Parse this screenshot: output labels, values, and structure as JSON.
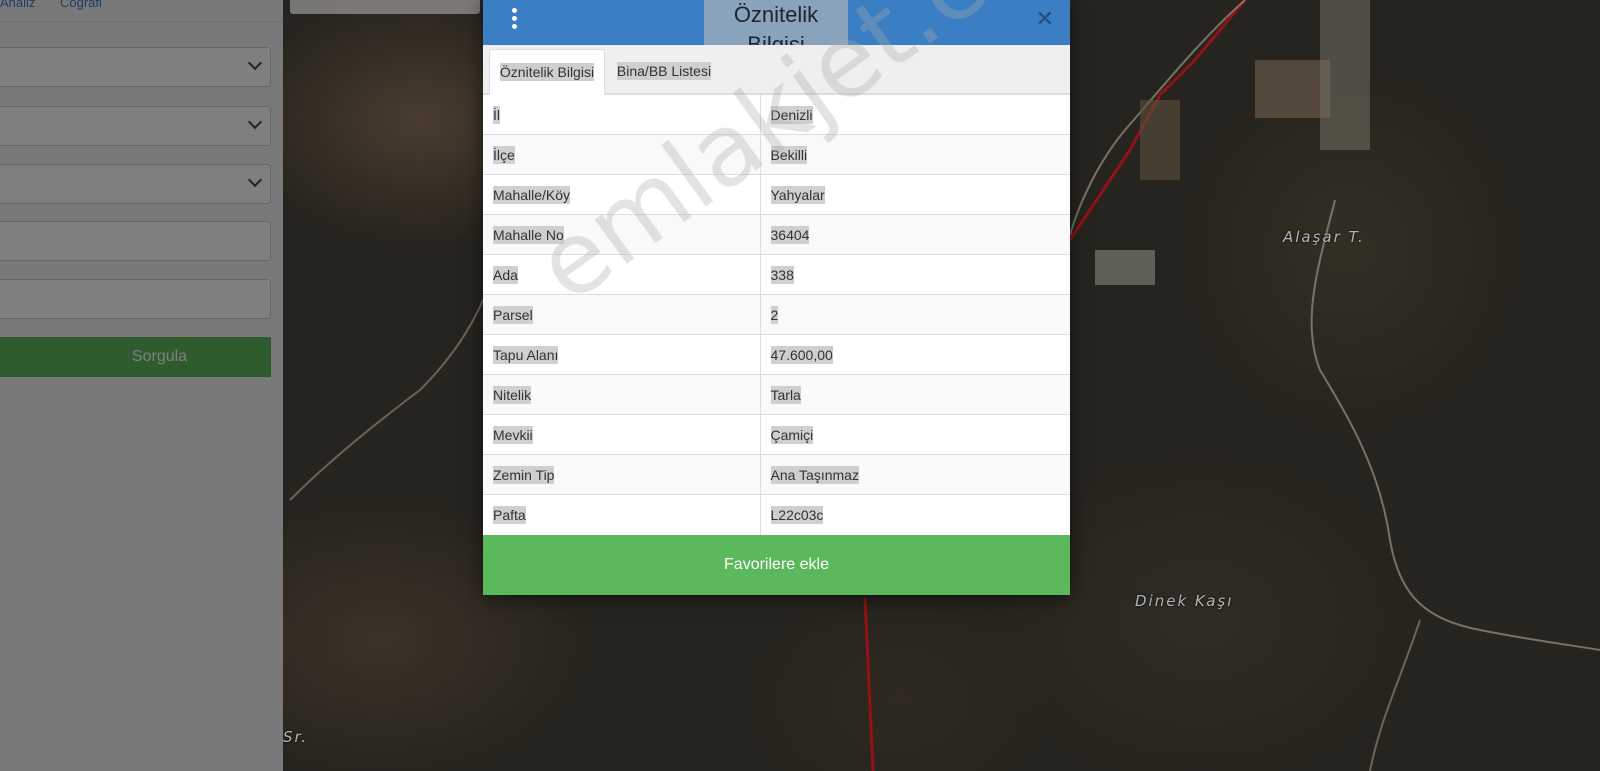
{
  "left_panel": {
    "tabs": [
      "Analiz",
      "Coğrafi"
    ],
    "query_button": "Sorgula"
  },
  "map": {
    "labels": [
      "Alaşar T.",
      "Dinek Kaşı",
      "Sr."
    ]
  },
  "modal": {
    "title": "Öznitelik Bilgisi",
    "close": "✕",
    "tabs": [
      {
        "label": "Öznitelik Bilgisi",
        "active": true
      },
      {
        "label": "Bina/BB Listesi",
        "active": false
      }
    ],
    "rows": [
      {
        "key": "İl",
        "value": "Denizli"
      },
      {
        "key": "İlçe",
        "value": "Bekilli"
      },
      {
        "key": "Mahalle/Köy",
        "value": "Yahyalar"
      },
      {
        "key": "Mahalle No",
        "value": "36404"
      },
      {
        "key": "Ada",
        "value": "338"
      },
      {
        "key": "Parsel",
        "value": "2"
      },
      {
        "key": "Tapu Alanı",
        "value": "47.600,00"
      },
      {
        "key": "Nitelik",
        "value": "Tarla"
      },
      {
        "key": "Mevkii",
        "value": "Çamiçi"
      },
      {
        "key": "Zemin Tip",
        "value": "Ana Taşınmaz"
      },
      {
        "key": "Pafta",
        "value": "L22c03c"
      }
    ],
    "favorite_button": "Favorilere ekle"
  },
  "watermark": "emlakjet.com",
  "colors": {
    "header_blue": "#3a7fc4",
    "success_green": "#5cb85c",
    "parcel_line_red": "#b3161b"
  }
}
